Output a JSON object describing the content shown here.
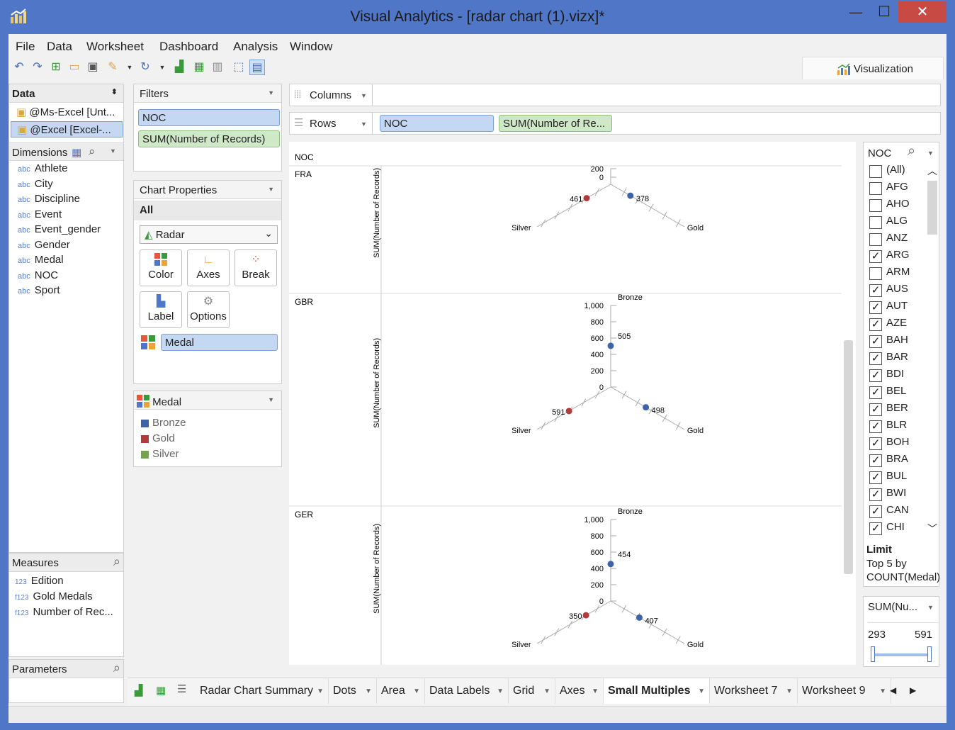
{
  "window": {
    "title": "Visual Analytics - [radar chart (1).vizx]*",
    "minimize": "—",
    "maximize": "☐",
    "close": "✕"
  },
  "menu": [
    "File",
    "Data",
    "Worksheet",
    "Dashboard",
    "Analysis",
    "Window"
  ],
  "toolbar": {
    "icons": [
      "undo-icon",
      "redo-icon",
      "new-icon",
      "open-icon",
      "save-icon",
      "brush-icon",
      "dropdown-icon",
      "refresh-icon",
      "dropdown-icon",
      "chart-add-icon",
      "chart-grid-icon",
      "chart-bar-icon",
      "select-icon",
      "presentation-icon"
    ],
    "visualization_tab": "Visualization"
  },
  "data_panel": {
    "title": "Data",
    "sources": [
      "@Ms-Excel [Unt...",
      "@Excel [Excel-..."
    ],
    "dimensions_title": "Dimensions",
    "dimensions": [
      "Athlete",
      "City",
      "Discipline",
      "Event",
      "Event_gender",
      "Gender",
      "Medal",
      "NOC",
      "Sport"
    ],
    "dim_type": "abc",
    "measures_title": "Measures",
    "measures": [
      {
        "type": "123",
        "label": "Edition"
      },
      {
        "type": "f123",
        "label": "Gold Medals"
      },
      {
        "type": "f123",
        "label": "Number of Rec..."
      }
    ],
    "parameters_title": "Parameters"
  },
  "filters": {
    "title": "Filters",
    "items": [
      "NOC",
      "SUM(Number of Records)"
    ]
  },
  "chart_properties": {
    "title": "Chart Properties",
    "tab": "All",
    "chart_type": "Radar",
    "buttons": [
      "Color",
      "Axes",
      "Break",
      "Label",
      "Options"
    ],
    "color_field": "Medal"
  },
  "legend": {
    "title": "Medal",
    "items": [
      {
        "label": "Bronze",
        "color": "#3e64a8"
      },
      {
        "label": "Gold",
        "color": "#b23a3a"
      },
      {
        "label": "Silver",
        "color": "#73a34a"
      }
    ]
  },
  "shelves": {
    "columns_label": "Columns",
    "rows_label": "Rows",
    "rows_pills": [
      "NOC",
      "SUM(Number of Re..."
    ]
  },
  "chart": {
    "header": "NOC",
    "axis_title": "SUM(Number of Records)",
    "point_colors": {
      "bronze": "#3e64a8",
      "gold": "#3e64a8",
      "silver": "#b23a3a"
    }
  },
  "chart_data": [
    {
      "type": "radar",
      "facet": "FRA",
      "axes": [
        "Bronze",
        "Gold",
        "Silver"
      ],
      "tick_labels": [
        "200",
        "0"
      ],
      "series": [
        {
          "values": {
            "Gold": 378,
            "Silver": 461
          }
        }
      ]
    },
    {
      "type": "radar",
      "facet": "GBR",
      "axes": [
        "Bronze",
        "Gold",
        "Silver"
      ],
      "tick_labels": [
        "1,000",
        "800",
        "600",
        "400",
        "200",
        "0"
      ],
      "series": [
        {
          "values": {
            "Bronze": 505,
            "Gold": 498,
            "Silver": 591
          }
        }
      ]
    },
    {
      "type": "radar",
      "facet": "GER",
      "axes": [
        "Bronze",
        "Gold",
        "Silver"
      ],
      "tick_labels": [
        "1,000",
        "800",
        "600",
        "400",
        "200",
        "0"
      ],
      "series": [
        {
          "values": {
            "Bronze": 454,
            "Gold": 407,
            "Silver": 350
          }
        }
      ]
    }
  ],
  "noc_filter": {
    "title": "NOC",
    "items": [
      {
        "label": "(All)",
        "checked": false
      },
      {
        "label": "AFG",
        "checked": false
      },
      {
        "label": "AHO",
        "checked": false
      },
      {
        "label": "ALG",
        "checked": false
      },
      {
        "label": "ANZ",
        "checked": false
      },
      {
        "label": "ARG",
        "checked": true
      },
      {
        "label": "ARM",
        "checked": false
      },
      {
        "label": "AUS",
        "checked": true
      },
      {
        "label": "AUT",
        "checked": true
      },
      {
        "label": "AZE",
        "checked": true
      },
      {
        "label": "BAH",
        "checked": true
      },
      {
        "label": "BAR",
        "checked": true
      },
      {
        "label": "BDI",
        "checked": true
      },
      {
        "label": "BEL",
        "checked": true
      },
      {
        "label": "BER",
        "checked": true
      },
      {
        "label": "BLR",
        "checked": true
      },
      {
        "label": "BOH",
        "checked": true
      },
      {
        "label": "BRA",
        "checked": true
      },
      {
        "label": "BUL",
        "checked": true
      },
      {
        "label": "BWI",
        "checked": true
      },
      {
        "label": "CAN",
        "checked": true
      },
      {
        "label": "CHI",
        "checked": true
      }
    ],
    "limit_title": "Limit",
    "limit_line1": "Top 5 by",
    "limit_line2": "COUNT(Medal)"
  },
  "range_filter": {
    "title": "SUM(Nu...",
    "min": "293",
    "max": "591"
  },
  "sheet_tabs": [
    "Radar Chart Summary",
    "Dots",
    "Area",
    "Data Labels",
    "Grid",
    "Axes",
    "Small Multiples",
    "Worksheet 7",
    "Worksheet 9"
  ],
  "active_tab": "Small Multiples"
}
